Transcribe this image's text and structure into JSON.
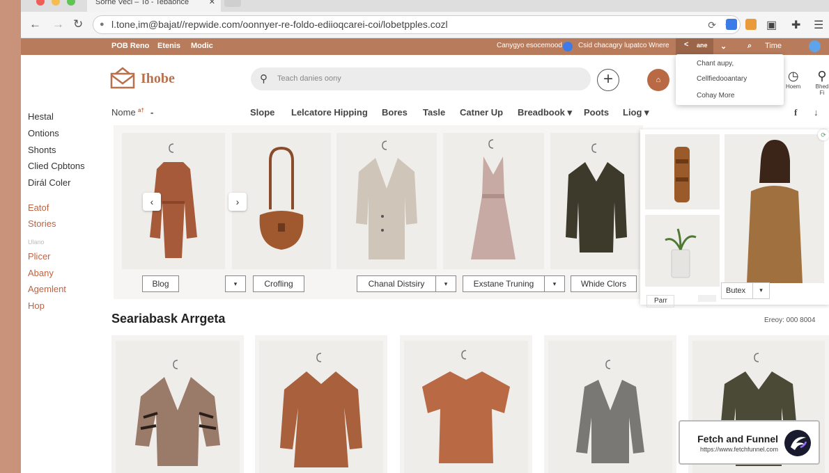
{
  "browser": {
    "tab_title": "Sorne Vecl – To - Tebaonce",
    "tab_close": "✕",
    "url": "l.tone,im@bajat//repwide.com/oonnyer-re-foldo-ediioqcarei-coi/lobetpples.cozl"
  },
  "topstrip": {
    "left_links": [
      "POB Reno",
      "Etenis",
      "Modic"
    ],
    "right_text_1": "Canygyo esocemood",
    "right_text_2": "Csid chacagry lupatco Wnere",
    "share_label": "ane",
    "chevron": "⌄",
    "time_label": "Time"
  },
  "dropdown": {
    "items": [
      "Chant aupy,",
      "Cellfiedooantary",
      "Cohay More"
    ]
  },
  "header": {
    "logo_text": "Ihobe",
    "search_placeholder": "Teach danies oony",
    "add_symbol": "+",
    "avatar_symbol": "⌂",
    "icons": [
      {
        "name": "clock-icon",
        "glyph": "◷",
        "label": "Hoem"
      },
      {
        "name": "search-icon",
        "glyph": "⚲",
        "label": "Bhed Fi"
      }
    ]
  },
  "sidebar": {
    "group1": [
      "Hestal",
      "Ontions",
      "Shonts",
      "Clied Cpbtons",
      "Dirál Coler"
    ],
    "group2": [
      "Eatof",
      "Stories"
    ],
    "faint_label": "Ulano",
    "group3": [
      "Plicer",
      "Abany",
      "Agemlent",
      "Hop"
    ]
  },
  "menu": {
    "first": "Nome",
    "first_badge": "a†",
    "first_caret": "-",
    "items": [
      "Slope",
      "Lelcatore Hipping",
      "Bores",
      "Tasle",
      "Catner Up",
      "Breadbook ▾",
      "Poots",
      "Liog ▾"
    ],
    "right_icons": [
      "f",
      "↓"
    ]
  },
  "product_row": {
    "buttons": [
      "Blog",
      "Crofling",
      "Chanal Distsiry",
      "Exstane Truning",
      "Whide Clors"
    ],
    "dropdown_glyph": "▾",
    "prev_arrow": "‹",
    "next_arrow": "›"
  },
  "side_panel": {
    "button": "Butex",
    "dropdown_glyph": "▾",
    "footer_label": "Parr"
  },
  "section": {
    "title": "Seariabask Arrgeta",
    "meta": "Ereoy: 000 8004"
  },
  "badge": {
    "title": "Fetch and Funnel",
    "url": "https://www.fetchfunnel.com"
  },
  "colors": {
    "accent": "#b87c5c",
    "brand_logo": "#b8714c",
    "link_accent": "#c0623f",
    "background_frame": "#c8937a"
  }
}
